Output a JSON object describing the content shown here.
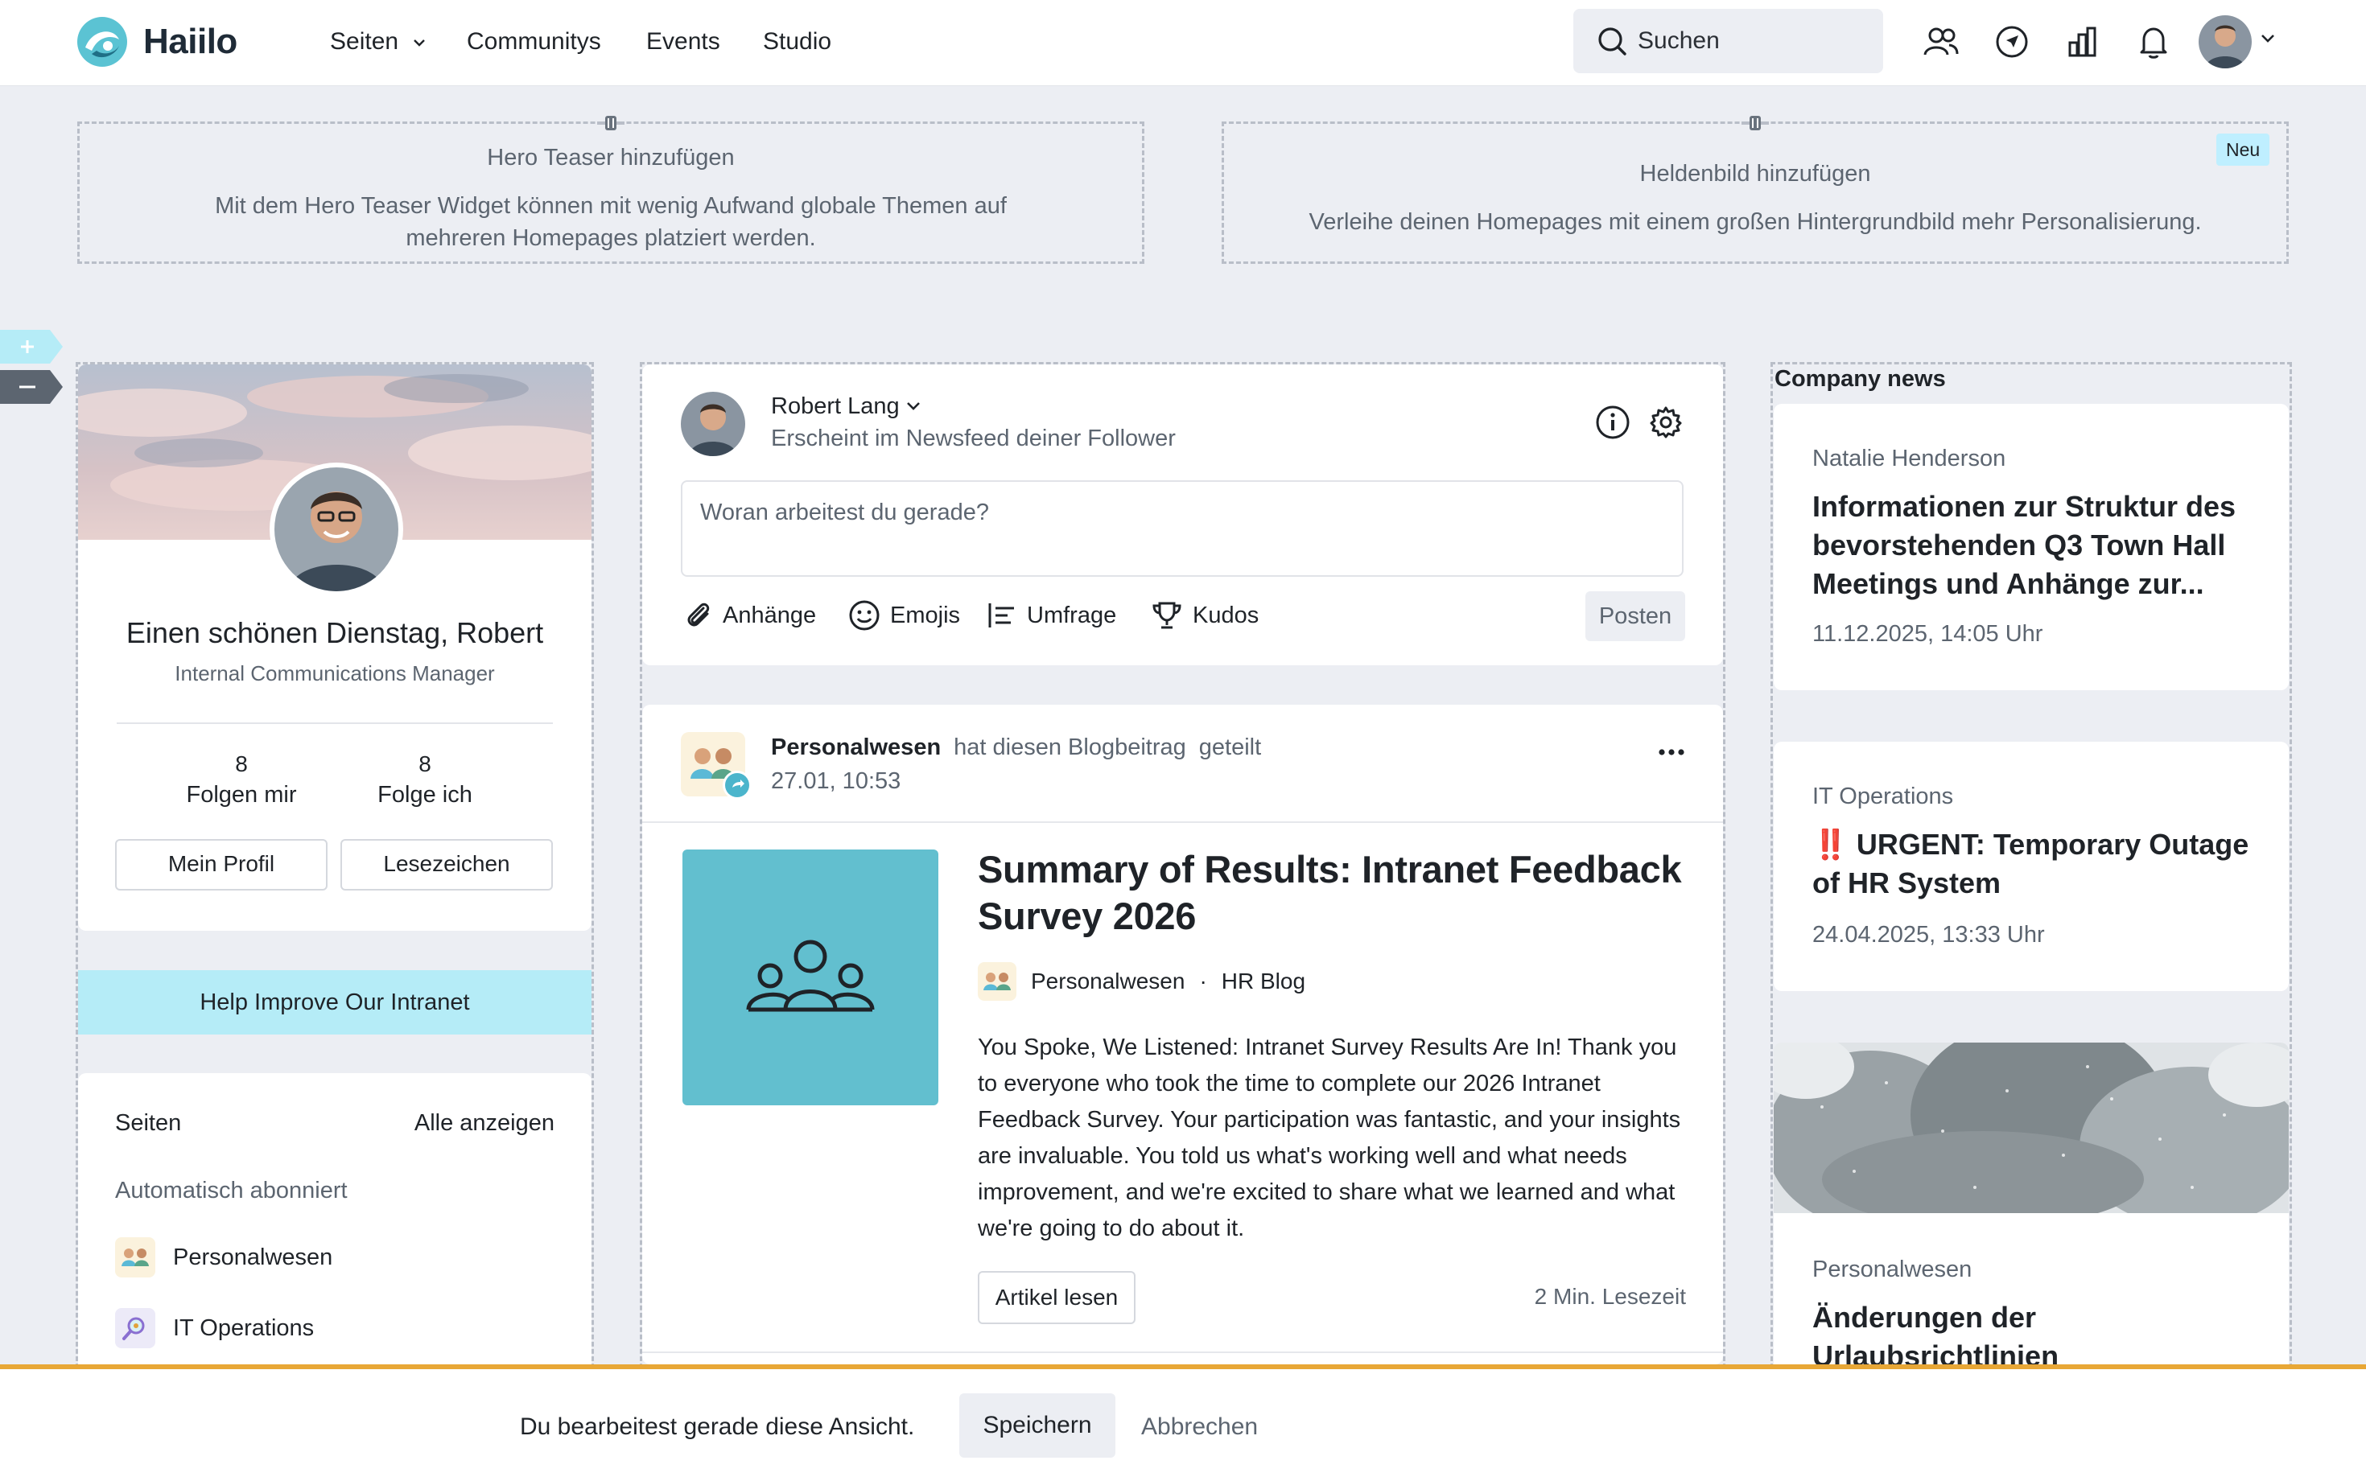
{
  "app": {
    "name": "Haiilo"
  },
  "nav": {
    "items": [
      {
        "label": "Seiten",
        "has_dropdown": true
      },
      {
        "label": "Communitys"
      },
      {
        "label": "Events"
      },
      {
        "label": "Studio"
      }
    ],
    "search_label": "Suchen",
    "icons": [
      "people-icon",
      "compass-icon",
      "chart-icon",
      "bell-icon"
    ]
  },
  "hero": {
    "left": {
      "title": "Hero Teaser hinzufügen",
      "desc": "Mit dem Hero Teaser Widget können mit wenig Aufwand globale Themen auf mehreren Homepages platziert werden."
    },
    "right": {
      "title": "Heldenbild hinzufügen",
      "desc": "Verleihe deinen Homepages mit einem großen Hintergrundbild mehr Personalisierung.",
      "badge": "Neu"
    }
  },
  "profile": {
    "greeting": "Einen schönen Dienstag, Robert",
    "role": "Internal Communications Manager",
    "followers_count": "8",
    "followers_label": "Folgen mir",
    "following_count": "8",
    "following_label": "Folge ich",
    "btn_profile": "Mein Profil",
    "btn_bookmarks": "Lesezeichen"
  },
  "help_banner": "Help Improve Our Intranet",
  "pages_widget": {
    "title": "Seiten",
    "show_all": "Alle anzeigen",
    "subtitle": "Automatisch abonniert",
    "items": [
      {
        "label": "Personalwesen"
      },
      {
        "label": "IT Operations"
      }
    ]
  },
  "composer": {
    "name": "Robert Lang",
    "subtitle": "Erscheint im Newsfeed deiner Follower",
    "placeholder": "Woran arbeitest du gerade?",
    "actions": [
      "Anhänge",
      "Emojis",
      "Umfrage",
      "Kudos"
    ],
    "post_label": "Posten"
  },
  "feed_post": {
    "author": "Personalwesen",
    "action": "hat diesen Blogbeitrag",
    "action2": "geteilt",
    "time": "27.01, 10:53",
    "title": "Summary of Results: Intranet Feedback Survey 2026",
    "source": "Personalwesen",
    "separator": "·",
    "blog": "HR Blog",
    "body": "You Spoke, We Listened: Intranet Survey Results Are In! Thank you to everyone who took the time to complete our 2026 Intranet Feedback Survey. Your participation was fantastic, and your insights are invaluable. You told us what's working well and what needs improvement, and we're excited to share what we learned and what we're going to do about it.",
    "read_button": "Artikel lesen",
    "read_time": "2 Min. Lesezeit",
    "thumb_color": "#62bfcf"
  },
  "news": {
    "heading": "Company news",
    "items": [
      {
        "author": "Natalie Henderson",
        "title": "Informationen zur Struktur des bevorstehenden Q3 Town Hall Meetings und Anhänge zur...",
        "date": "11.12.2025, 14:05 Uhr"
      },
      {
        "author": "IT Operations",
        "prefix": "‼️",
        "title": "URGENT: Temporary Outage of HR System",
        "date": "24.04.2025, 13:33 Uhr"
      },
      {
        "author": "Personalwesen",
        "title": "Änderungen der Urlaubsrichtlinien",
        "date": ""
      }
    ]
  },
  "edit_bar": {
    "text": "Du bearbeitest gerade diese Ansicht.",
    "save": "Speichern",
    "cancel": "Abbrechen"
  },
  "colors": {
    "accent_cyan": "#b5ecf7",
    "edit_bar_border": "#e8a736",
    "background": "#eceef3"
  }
}
